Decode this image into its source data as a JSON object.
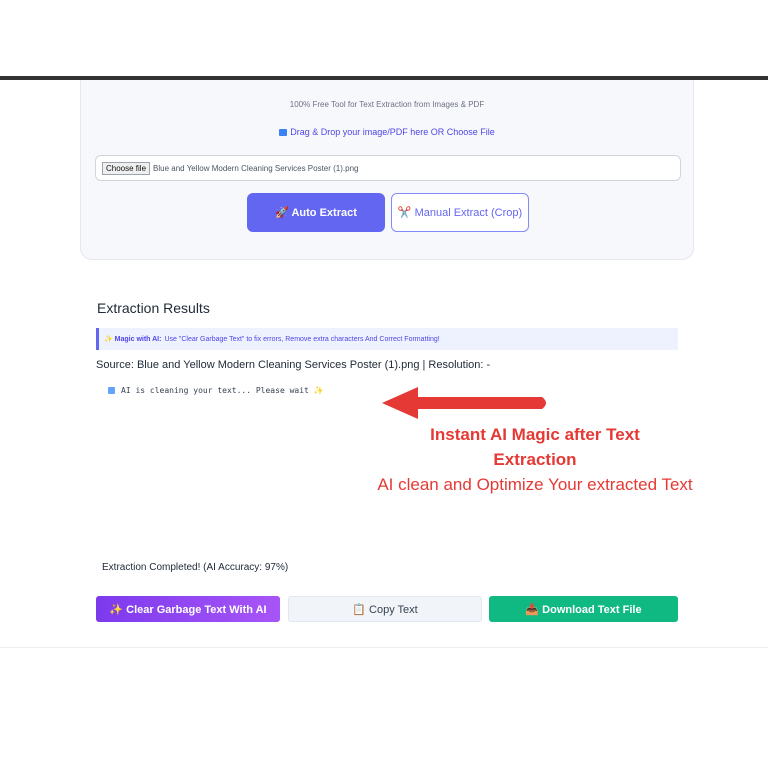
{
  "upload": {
    "tagline": "100% Free Tool for Text Extraction from Images & PDF",
    "drop_text": "Drag & Drop your image/PDF here OR Choose File",
    "choose_file_label": "Choose file",
    "file_name": "Blue and Yellow Modern Cleaning Services Poster (1).png",
    "auto_extract_label": "🚀 Auto Extract",
    "manual_extract_label": "✂️ Manual Extract (Crop)"
  },
  "results": {
    "title": "Extraction Results",
    "magic_label": "✨ Magic with AI:",
    "magic_text": "Use \"Clear Garbage Text\" to fix errors, Remove extra characters And Correct Formatting!",
    "source_line": "Source: Blue and Yellow Modern Cleaning Services Poster (1).png | Resolution: -",
    "cleaning_text": "AI is cleaning your text... Please wait ✨",
    "completed_text": "Extraction Completed! (AI Accuracy: 97%)"
  },
  "promo": {
    "title": "Instant AI Magic after Text Extraction",
    "subtitle": "AI clean and Optimize Your extracted Text"
  },
  "actions": {
    "clear_label": "✨ Clear Garbage Text With AI",
    "copy_label": "📋 Copy Text",
    "download_label": "📥 Download Text File"
  },
  "colors": {
    "accent": "#6366f1",
    "promo_red": "#e53935",
    "download_green": "#10b981",
    "clear_purple": "#8b5cf6"
  }
}
